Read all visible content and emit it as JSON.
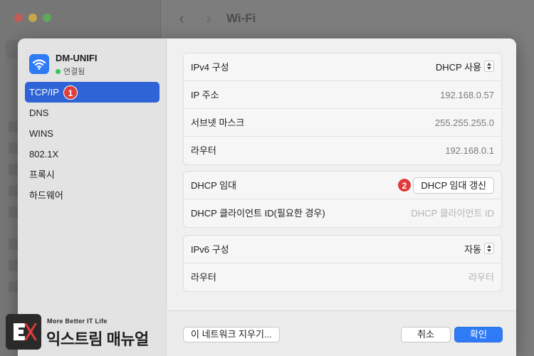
{
  "background_window": {
    "title": "Wi-Fi",
    "back_glyph": "‹",
    "forward_glyph": "›"
  },
  "sidebar": {
    "network_name": "DM-UNIFI",
    "network_status": "연결됨",
    "items": [
      {
        "label": "TCP/IP",
        "selected": true,
        "badge": "1"
      },
      {
        "label": "DNS"
      },
      {
        "label": "WINS"
      },
      {
        "label": "802.1X"
      },
      {
        "label": "프록시"
      },
      {
        "label": "하드웨어"
      }
    ]
  },
  "ipv4": {
    "config_label": "IPv4 구성",
    "config_value": "DHCP 사용",
    "ip_label": "IP 주소",
    "ip_value": "192.168.0.57",
    "subnet_label": "서브넷 마스크",
    "subnet_value": "255.255.255.0",
    "router_label": "라우터",
    "router_value": "192.168.0.1"
  },
  "dhcp": {
    "lease_label": "DHCP 임대",
    "renew_button": "DHCP 임대 갱신",
    "badge": "2",
    "client_id_label": "DHCP 클라이언트 ID(필요한 경우)",
    "client_id_placeholder": "DHCP 클라이언트 ID"
  },
  "ipv6": {
    "config_label": "IPv6 구성",
    "config_value": "자동",
    "router_label": "라우터",
    "router_placeholder": "라우터"
  },
  "footer": {
    "forget_button": "이 네트워크 지우기...",
    "cancel_button": "취소",
    "ok_button": "확인"
  },
  "watermark": {
    "tagline": "More Better IT Life",
    "name": "익스트림 매뉴얼"
  },
  "colors": {
    "accent": "#2f7bf5",
    "selection": "#2e64d6",
    "badge": "#e03c3c",
    "status_connected": "#34c759"
  },
  "icons": {
    "network": "wifi-icon",
    "stepper": "updown-stepper-icon",
    "status": "connected-dot-icon",
    "logo": "ex-logo-icon"
  }
}
